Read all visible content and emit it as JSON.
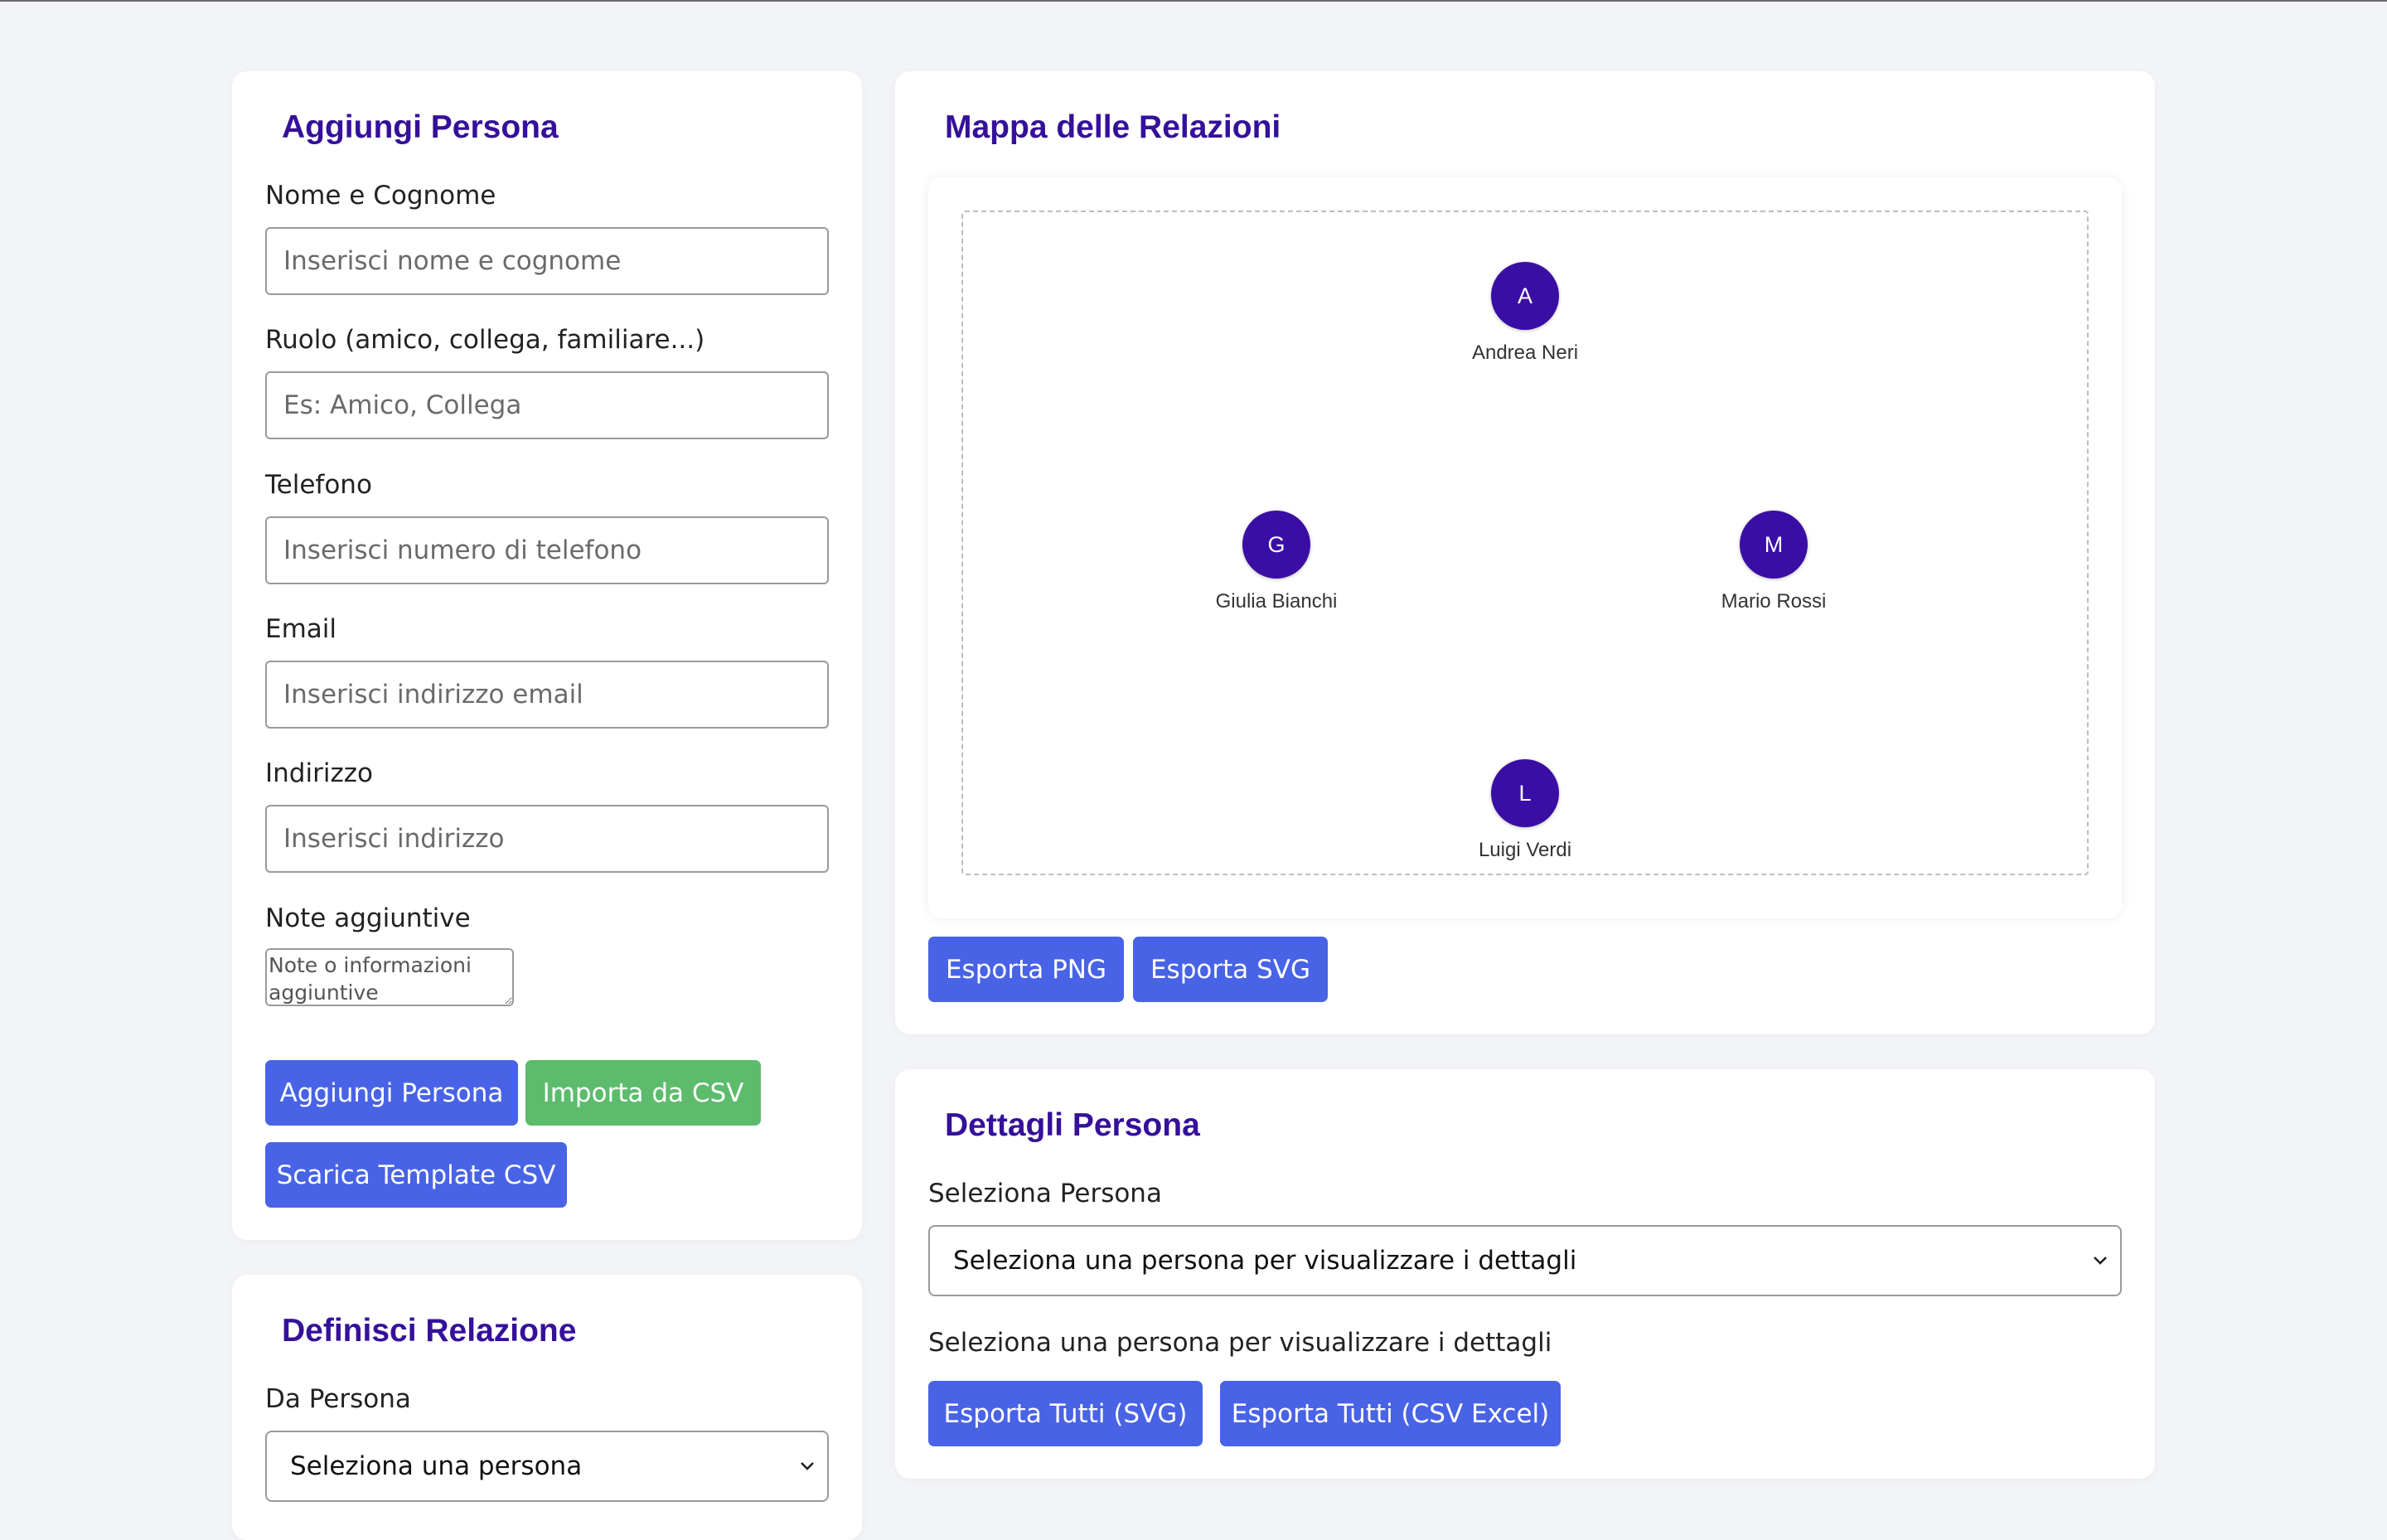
{
  "add_person": {
    "title": "Aggiungi Persona",
    "fields": {
      "name": {
        "label": "Nome e Cognome",
        "placeholder": "Inserisci nome e cognome"
      },
      "role": {
        "label": "Ruolo (amico, collega, familiare...)",
        "placeholder": "Es: Amico, Collega"
      },
      "phone": {
        "label": "Telefono",
        "placeholder": "Inserisci numero di telefono"
      },
      "email": {
        "label": "Email",
        "placeholder": "Inserisci indirizzo email"
      },
      "address": {
        "label": "Indirizzo",
        "placeholder": "Inserisci indirizzo"
      },
      "notes": {
        "label": "Note aggiuntive",
        "placeholder": "Note o informazioni aggiuntive"
      }
    },
    "buttons": {
      "add": "Aggiungi Persona",
      "import_csv": "Importa da CSV",
      "download_template": "Scarica Template CSV"
    }
  },
  "define_relation": {
    "title": "Definisci Relazione",
    "from_label": "Da Persona",
    "from_selected": "Seleziona una persona"
  },
  "relation_map": {
    "title": "Mappa delle Relazioni",
    "nodes": [
      {
        "initial": "A",
        "name": "Andrea Neri"
      },
      {
        "initial": "G",
        "name": "Giulia Bianchi"
      },
      {
        "initial": "M",
        "name": "Mario Rossi"
      },
      {
        "initial": "L",
        "name": "Luigi Verdi"
      }
    ],
    "buttons": {
      "export_png": "Esporta PNG",
      "export_svg": "Esporta SVG"
    }
  },
  "person_details": {
    "title": "Dettagli Persona",
    "select_label": "Seleziona Persona",
    "select_value": "Seleziona una persona per visualizzare i dettagli",
    "empty_message": "Seleziona una persona per visualizzare i dettagli",
    "buttons": {
      "export_all_svg": "Esporta Tutti (SVG)",
      "export_all_csv": "Esporta Tutti (CSV Excel)"
    }
  },
  "colors": {
    "accent_title": "#35109a",
    "button_blue": "#4863e6",
    "button_green": "#5cbc6c",
    "node_fill": "#3a0ea5"
  }
}
